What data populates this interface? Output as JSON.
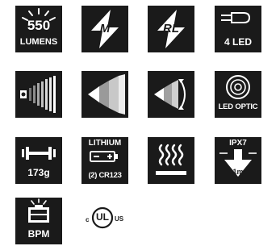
{
  "colors": {
    "tile_bg": "#1a1a1a",
    "icon": "#ffffff",
    "page_bg": "#ffffff"
  },
  "icons": [
    {
      "name": "lumens-icon",
      "value": "550",
      "caption": "LUMENS"
    },
    {
      "name": "mode-m-icon",
      "caption": "M"
    },
    {
      "name": "mode-rl-icon",
      "caption": "RL"
    },
    {
      "name": "led-bulb-icon",
      "caption": "4 LED"
    },
    {
      "name": "brightness-levels-icon"
    },
    {
      "name": "beam-pattern-icon"
    },
    {
      "name": "adjustable-beam-icon"
    },
    {
      "name": "led-optic-icon",
      "caption": "LED OPTIC"
    },
    {
      "name": "weight-icon",
      "caption": "173g"
    },
    {
      "name": "lithium-battery-icon",
      "title": "LITHIUM",
      "caption": "(2) CR123"
    },
    {
      "name": "heat-resistant-icon"
    },
    {
      "name": "waterproof-icon",
      "rating": "IPX7",
      "caption": "1m"
    },
    {
      "name": "battery-power-meter-icon",
      "caption": "BPM"
    }
  ],
  "certification": {
    "name": "cul-us-listed-mark",
    "left": "c",
    "center": "UL",
    "right": "US"
  }
}
